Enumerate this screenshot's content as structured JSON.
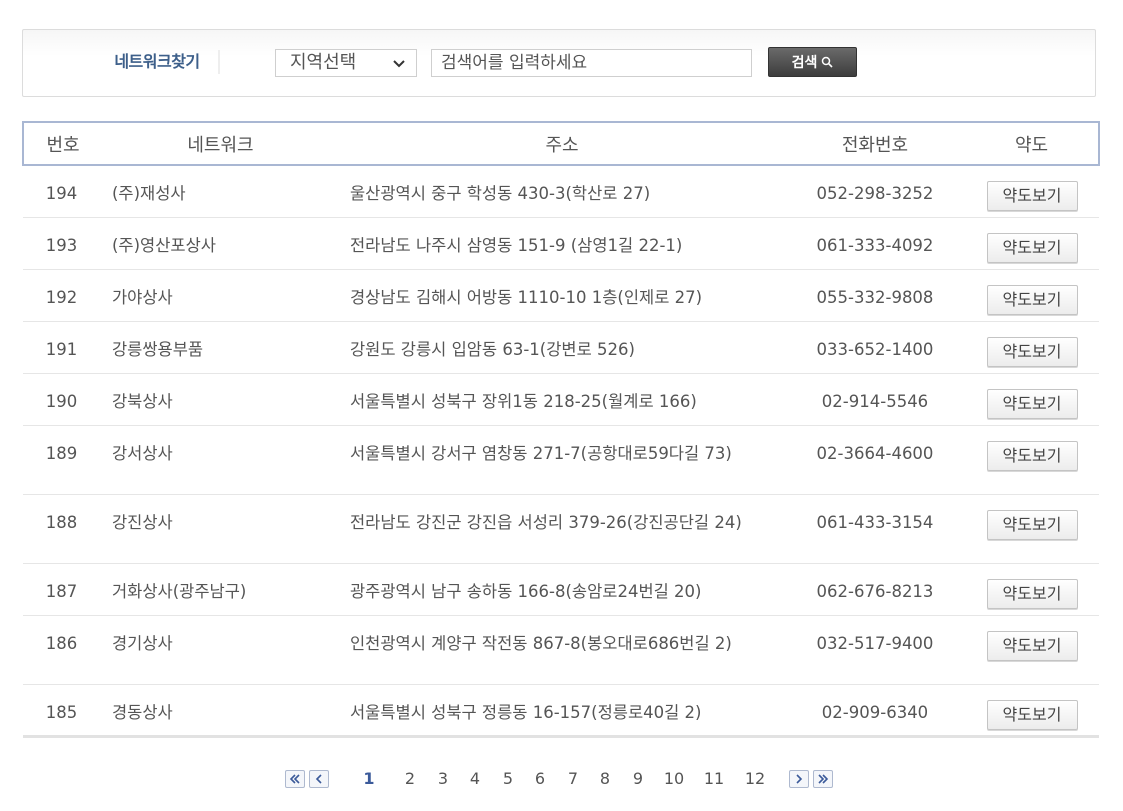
{
  "search": {
    "title": "네트워크찾기",
    "region_label": "지역선택",
    "input_placeholder": "검색어를 입력하세요",
    "button_label": "검색"
  },
  "table": {
    "headers": [
      "번호",
      "네트워크",
      "주소",
      "전화번호",
      "약도"
    ],
    "map_button_label": "약도보기",
    "rows": [
      {
        "num": "194",
        "name": "(주)재성사",
        "addr": "울산광역시   중구 학성동 430-3(학산로 27)",
        "phone": "052-298-3252"
      },
      {
        "num": "193",
        "name": "(주)영산포상사",
        "addr": "전라남도   나주시 삼영동 151-9 (삼영1길 22-1)",
        "phone": "061-333-4092"
      },
      {
        "num": "192",
        "name": "가야상사",
        "addr": "경상남도   김해시 어방동 1110-10 1층(인제로 27)",
        "phone": "055-332-9808"
      },
      {
        "num": "191",
        "name": "강릉쌍용부품",
        "addr": "강원도   강릉시 입암동 63-1(강변로 526)",
        "phone": "033-652-1400"
      },
      {
        "num": "190",
        "name": "강북상사",
        "addr": "서울특별시   성북구 장위1동 218-25(월계로 166)",
        "phone": "02-914-5546"
      },
      {
        "num": "189",
        "name": "강서상사",
        "addr": "서울특별시   강서구 염창동 271-7(공항대로59다길 73)",
        "phone": "02-3664-4600"
      },
      {
        "num": "188",
        "name": "강진상사",
        "addr": "전라남도   강진군 강진읍 서성리 379-26(강진공단길 24)",
        "phone": "061-433-3154"
      },
      {
        "num": "187",
        "name": "거화상사(광주남구)",
        "addr": "광주광역시   남구 송하동 166-8(송암로24번길 20)",
        "phone": "062-676-8213"
      },
      {
        "num": "186",
        "name": "경기상사",
        "addr": "인천광역시   계양구 작전동 867-8(봉오대로686번길 2)",
        "phone": "032-517-9400"
      },
      {
        "num": "185",
        "name": "경동상사",
        "addr": "서울특별시   성북구 정릉동 16-157(정릉로40길 2)",
        "phone": "02-909-6340"
      }
    ]
  },
  "pagination": {
    "current": "1",
    "pages": [
      "1",
      "2",
      "3",
      "4",
      "5",
      "6",
      "7",
      "8",
      "9",
      "10",
      "11",
      "12"
    ]
  },
  "colors": {
    "title_blue": "#3d5f8a",
    "header_border": "#a9b7d3",
    "button_dark": "#4a4a4a"
  }
}
